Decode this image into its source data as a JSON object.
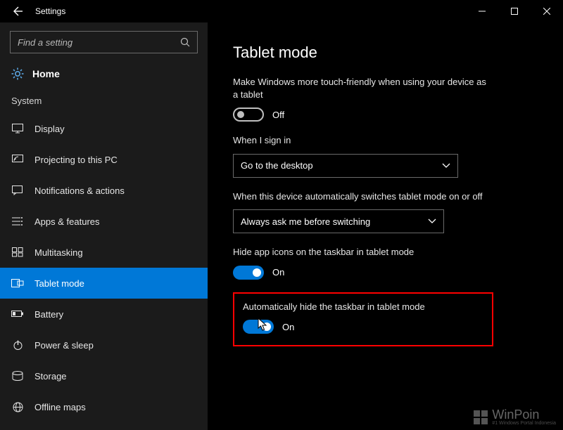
{
  "window": {
    "title": "Settings"
  },
  "search": {
    "placeholder": "Find a setting"
  },
  "home_label": "Home",
  "section_label": "System",
  "nav": [
    {
      "icon": "display-icon",
      "label": "Display",
      "selected": false
    },
    {
      "icon": "projecting-icon",
      "label": "Projecting to this PC",
      "selected": false
    },
    {
      "icon": "notifications-icon",
      "label": "Notifications & actions",
      "selected": false
    },
    {
      "icon": "apps-icon",
      "label": "Apps & features",
      "selected": false
    },
    {
      "icon": "multitasking-icon",
      "label": "Multitasking",
      "selected": false
    },
    {
      "icon": "tablet-mode-icon",
      "label": "Tablet mode",
      "selected": true
    },
    {
      "icon": "battery-icon",
      "label": "Battery",
      "selected": false
    },
    {
      "icon": "power-sleep-icon",
      "label": "Power & sleep",
      "selected": false
    },
    {
      "icon": "storage-icon",
      "label": "Storage",
      "selected": false
    },
    {
      "icon": "offline-maps-icon",
      "label": "Offline maps",
      "selected": false
    }
  ],
  "page": {
    "title": "Tablet mode",
    "touch_friendly_label": "Make Windows more touch-friendly when using your device as a tablet",
    "touch_friendly_state": "Off",
    "signin_label": "When I sign in",
    "signin_value": "Go to the desktop",
    "auto_switch_label": "When this device automatically switches tablet mode on or off",
    "auto_switch_value": "Always ask me before switching",
    "hide_icons_label": "Hide app icons on the taskbar in tablet mode",
    "hide_icons_state": "On",
    "auto_hide_label": "Automatically hide the taskbar in tablet mode",
    "auto_hide_state": "On"
  },
  "watermark": {
    "brand": "WinPoin",
    "tagline": "#1 Windows Portal Indonesia"
  }
}
